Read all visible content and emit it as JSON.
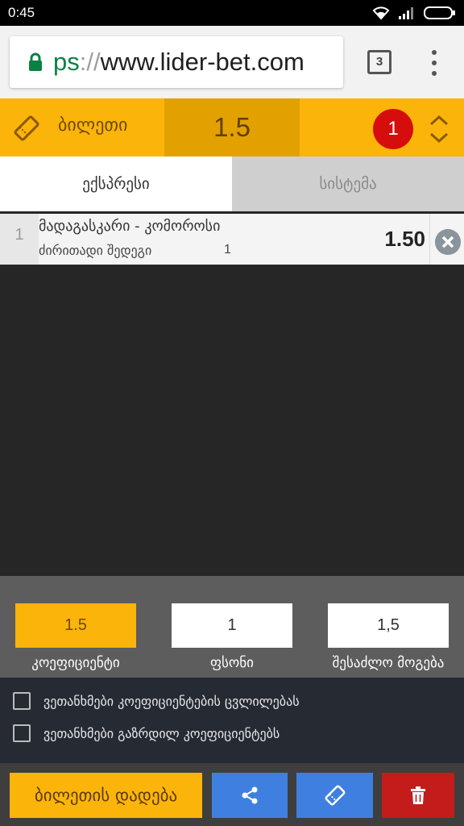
{
  "status_bar": {
    "time": "0:45"
  },
  "browser": {
    "url_scheme": "ps",
    "url_separator": "://",
    "url_host": "www.lider-bet.com",
    "tab_count": "3"
  },
  "ticket": {
    "title": "ბილეთი",
    "total_odds": "1.5",
    "count": "1"
  },
  "tabs": [
    {
      "label": "ექსპრესი",
      "active": true
    },
    {
      "label": "სისტემა",
      "active": false
    }
  ],
  "bets": [
    {
      "index": "1",
      "event": "მადაგასკარი - კომოროსი",
      "market": "ძირითადი შედეგი",
      "outcome": "1",
      "odds": "1.50"
    }
  ],
  "summary": {
    "coefficient": {
      "value": "1.5",
      "label": "კოეფიციენტი"
    },
    "stake": {
      "value": "1",
      "label": "ფსონი"
    },
    "potential_win": {
      "value": "1,5",
      "label": "შესაძლო მოგება"
    }
  },
  "options": [
    {
      "label": "ვეთანხმები კოეფიციენტების ცვლილებას",
      "checked": false
    },
    {
      "label": "ვეთანხმები გაზრდილ კოეფიციენტებს",
      "checked": false
    }
  ],
  "actions": {
    "place_bet_label": "ბილეთის დადება",
    "share_icon": "share-icon",
    "ticket_icon": "ticket-icon",
    "delete_icon": "trash-icon"
  },
  "colors": {
    "accent": "#fbb40a",
    "accent_dark": "#e3a100",
    "badge": "#d60d0d",
    "share_blue": "#3f7fe0",
    "delete_red": "#c41b1b"
  }
}
